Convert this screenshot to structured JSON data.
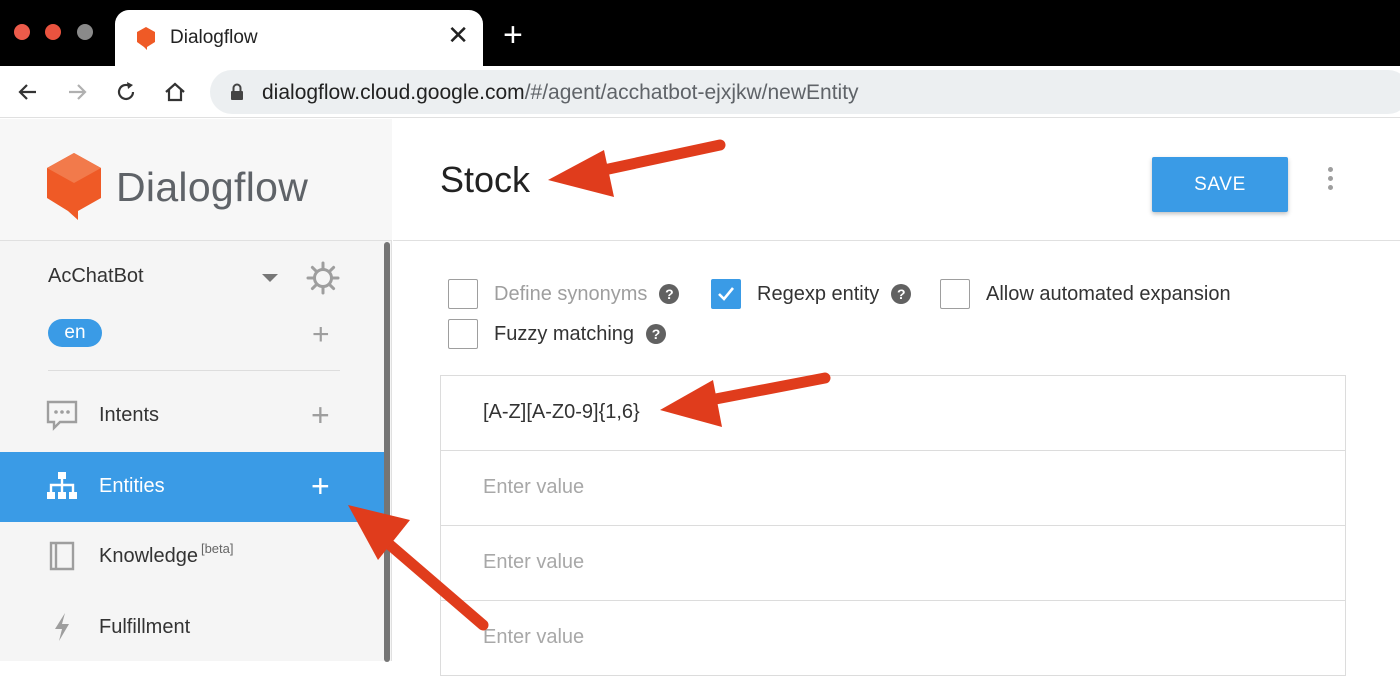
{
  "browser": {
    "tab_title": "Dialogflow",
    "tab_close": "✕",
    "new_tab": "+",
    "url_host": "dialogflow.cloud.google.com",
    "url_path": "/#/agent/acchatbot-ejxjkw/newEntity"
  },
  "sidebar": {
    "logo_text": "Dialogflow",
    "agent_name": "AcChatBot",
    "language": "en",
    "language_add": "+",
    "items": [
      {
        "label": "Intents",
        "icon": "chat-bubble-icon",
        "add": "+",
        "active": false
      },
      {
        "label": "Entities",
        "icon": "hierarchy-icon",
        "add": "+",
        "active": true
      },
      {
        "label": "Knowledge",
        "sup": "[beta]",
        "icon": "book-icon",
        "active": false
      },
      {
        "label": "Fulfillment",
        "icon": "lightning-icon",
        "active": false
      }
    ]
  },
  "header": {
    "title": "Stock",
    "save_label": "SAVE"
  },
  "options": {
    "define_synonyms": {
      "label": "Define synonyms",
      "checked": false,
      "disabled": true
    },
    "regexp_entity": {
      "label": "Regexp entity",
      "checked": true
    },
    "allow_expansion": {
      "label": "Allow automated expansion",
      "checked": false
    },
    "fuzzy_matching": {
      "label": "Fuzzy matching",
      "checked": false
    },
    "help_glyph": "?"
  },
  "entries": {
    "rows": [
      {
        "value": "[A-Z][A-Z0-9]{1,6}",
        "placeholder": "Enter value"
      },
      {
        "value": "",
        "placeholder": "Enter value"
      },
      {
        "value": "",
        "placeholder": "Enter value"
      },
      {
        "value": "",
        "placeholder": "Enter value"
      }
    ]
  },
  "colors": {
    "accent": "#3a9be6",
    "annotation_arrow": "#e03c1c",
    "logo_orange": "#ef5a26"
  }
}
